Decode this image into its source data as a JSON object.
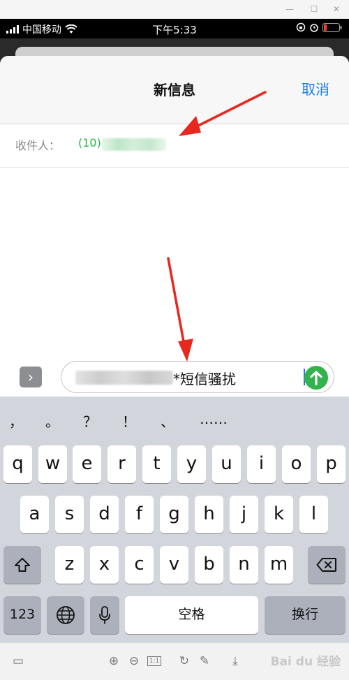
{
  "status_bar": {
    "carrier": "中国移动",
    "time": "下午5:33"
  },
  "nav": {
    "title": "新信息",
    "cancel_label": "取消"
  },
  "recipient": {
    "label": "收件人：",
    "value_prefix": "(10)"
  },
  "message": {
    "text_suffix": "*短信骚扰"
  },
  "keyboard": {
    "punctuation": [
      "，",
      "。",
      "？",
      "！",
      "、",
      "……"
    ],
    "row1": [
      "q",
      "w",
      "e",
      "r",
      "t",
      "y",
      "u",
      "i",
      "o",
      "p"
    ],
    "row2": [
      "a",
      "s",
      "d",
      "f",
      "g",
      "h",
      "j",
      "k",
      "l"
    ],
    "row3": [
      "z",
      "x",
      "c",
      "v",
      "b",
      "n",
      "m"
    ],
    "numbers_label": "123",
    "space_label": "空格",
    "return_label": "换行"
  },
  "icons": {
    "shift": "shift-icon",
    "backspace": "backspace-icon",
    "globe": "globe-icon",
    "mic": "microphone-icon",
    "send": "send-arrow-icon"
  },
  "watermark": "Bai du 经验",
  "colors": {
    "accent": "#1a7fe3",
    "recipient_green": "#2ab34a",
    "send_green": "#34b24d",
    "annotation_red": "#e8271f"
  }
}
